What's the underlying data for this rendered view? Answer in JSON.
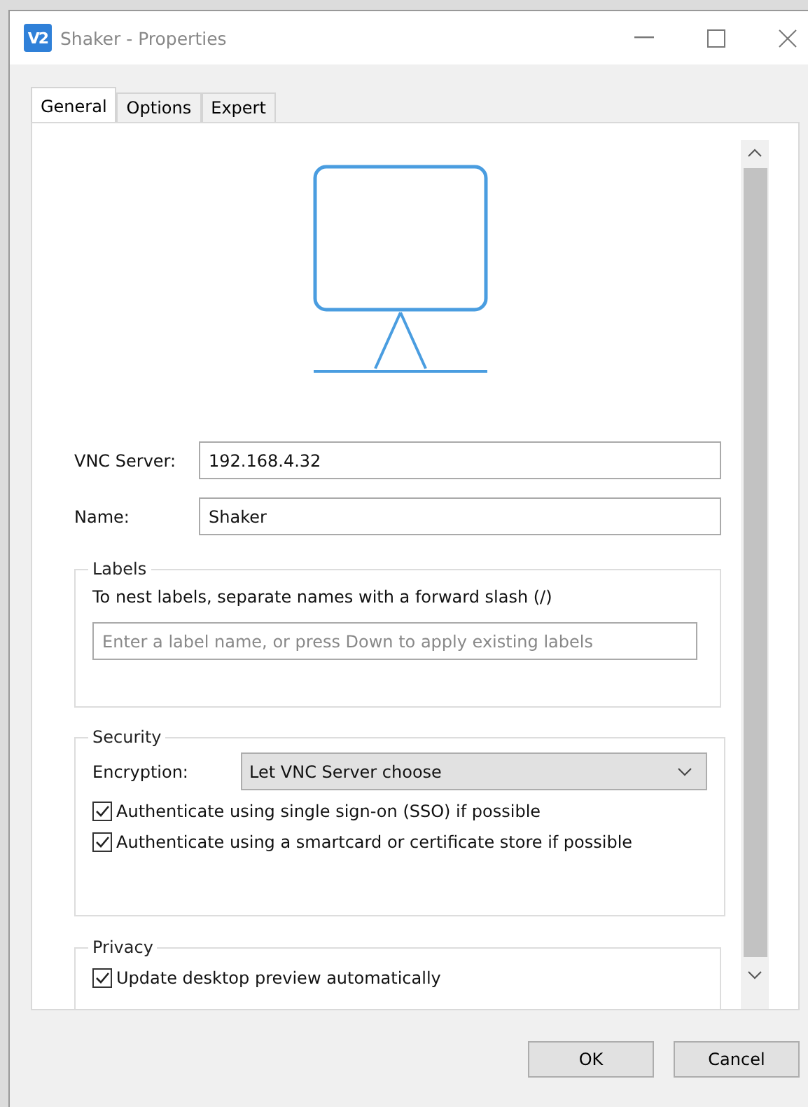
{
  "window": {
    "logo_text": "V2",
    "title": "Shaker - Properties"
  },
  "tabs": [
    {
      "label": "General",
      "selected": true
    },
    {
      "label": "Options",
      "selected": false
    },
    {
      "label": "Expert",
      "selected": false
    }
  ],
  "fields": [
    {
      "label": "VNC Server:",
      "value": "192.168.4.32"
    },
    {
      "label": "Name:",
      "value": "Shaker"
    }
  ],
  "labels_group": {
    "title": "Labels",
    "hint": "To nest labels, separate names with a forward slash (/)",
    "placeholder": "Enter a label name, or press Down to apply existing labels"
  },
  "security_group": {
    "title": "Security",
    "encryption_label": "Encryption:",
    "encryption_value": "Let VNC Server choose",
    "options": [
      {
        "label": "Authenticate using single sign-on (SSO) if possible",
        "checked": true
      },
      {
        "label": "Authenticate using a smartcard or certificate store if possible",
        "checked": true
      }
    ]
  },
  "privacy_group": {
    "title": "Privacy",
    "options": [
      {
        "label": "Update desktop preview automatically",
        "checked": true
      }
    ]
  },
  "buttons": [
    "OK",
    "Cancel"
  ]
}
